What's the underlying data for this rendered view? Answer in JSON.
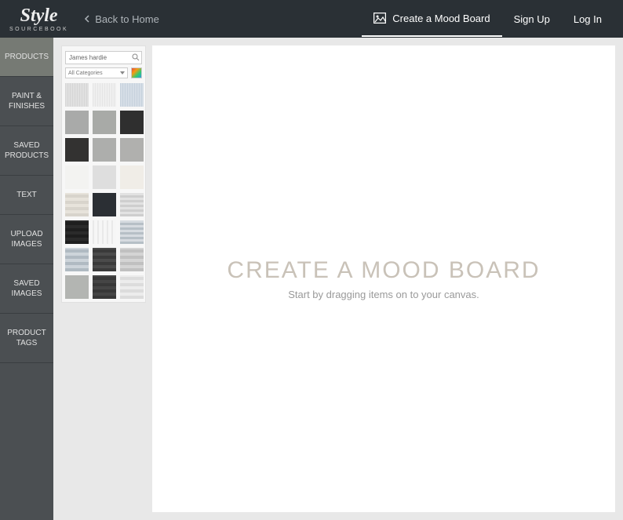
{
  "header": {
    "logo_top": "Style",
    "logo_bottom": "SOURCEBOOK",
    "back_label": "Back to Home",
    "create_label": "Create a Mood Board",
    "signup_label": "Sign Up",
    "login_label": "Log In"
  },
  "sidebar": {
    "items": [
      {
        "id": "products",
        "label": "PRODUCTS",
        "active": true
      },
      {
        "id": "paint",
        "label": "PAINT & FINISHES",
        "active": false
      },
      {
        "id": "saved-products",
        "label": "SAVED PRODUCTS",
        "active": false
      },
      {
        "id": "text",
        "label": "TEXT",
        "active": false
      },
      {
        "id": "upload",
        "label": "UPLOAD IMAGES",
        "active": false
      },
      {
        "id": "saved-images",
        "label": "SAVED IMAGES",
        "active": false
      },
      {
        "id": "tags",
        "label": "PRODUCT TAGS",
        "active": false
      }
    ]
  },
  "panel": {
    "search_value": "James hardie",
    "category_label": "All Categories",
    "swatches": [
      {
        "name": "cladding-vertical-grey",
        "cls": "sw-linen-v"
      },
      {
        "name": "cladding-vertical-lightgrey",
        "cls": "sw-linen-lg"
      },
      {
        "name": "cladding-vertical-blue",
        "cls": "sw-linen-bl"
      },
      {
        "name": "flat-grey-1",
        "cls": "sw-flat-g1"
      },
      {
        "name": "flat-grey-2",
        "cls": "sw-flat-g2"
      },
      {
        "name": "flat-dark",
        "cls": "sw-flat-dk"
      },
      {
        "name": "flat-charcoal",
        "cls": "sw-flat-chc"
      },
      {
        "name": "flat-midgrey",
        "cls": "sw-flat-mg"
      },
      {
        "name": "flat-silver",
        "cls": "sw-flat-sl"
      },
      {
        "name": "flat-white",
        "cls": "sw-flat-wh"
      },
      {
        "name": "flat-pale",
        "cls": "sw-flat-p1"
      },
      {
        "name": "flat-cream",
        "cls": "sw-flat-cr"
      },
      {
        "name": "horizontal-cream",
        "cls": "sw-hz-cr"
      },
      {
        "name": "flat-navy",
        "cls": "sw-flat-nv"
      },
      {
        "name": "horizontal-lightgrey",
        "cls": "sw-hz-lg"
      },
      {
        "name": "horizontal-dark",
        "cls": "sw-hz-dk"
      },
      {
        "name": "vertical-white",
        "cls": "sw-vl-wh"
      },
      {
        "name": "horizontal-blue",
        "cls": "sw-hz-bl"
      },
      {
        "name": "horizontal-blue-2",
        "cls": "sw-hz-bl2"
      },
      {
        "name": "horizontal-charcoal",
        "cls": "sw-hz-ch"
      },
      {
        "name": "horizontal-grey",
        "cls": "sw-hz-gr"
      },
      {
        "name": "flat-grey-3",
        "cls": "sw-flat-g3"
      },
      {
        "name": "horizontal-dark-2",
        "cls": "sw-hz-dk2"
      },
      {
        "name": "horizontal-light",
        "cls": "sw-hz-lt"
      }
    ]
  },
  "canvas": {
    "title": "CREATE A MOOD BOARD",
    "subtitle": "Start by dragging items on to your canvas."
  }
}
